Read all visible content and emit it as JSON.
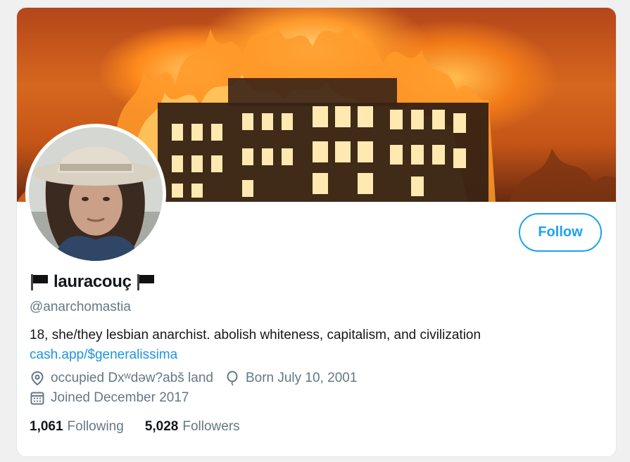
{
  "profile": {
    "display_name": "lauracouç",
    "handle": "@anarchomastia",
    "bio": "18, she/they lesbian anarchist. abolish whiteness, capitalism, and civilization",
    "link": "cash.app/$generalissima",
    "location": "occupied Dxʷdəw?abš land",
    "birthday": "Born July 10, 2001",
    "joined": "Joined December 2017"
  },
  "actions": {
    "follow_label": "Follow"
  },
  "stats": {
    "following_count": "1,061",
    "following_label": "Following",
    "followers_count": "5,028",
    "followers_label": "Followers"
  },
  "colors": {
    "accent": "#1da1f2",
    "link": "#1b95e0",
    "muted": "#657786",
    "text": "#14171a"
  },
  "icons": {
    "flag": "black-flag-icon",
    "location": "location-pin-icon",
    "birthday": "balloon-icon",
    "joined": "calendar-icon"
  }
}
